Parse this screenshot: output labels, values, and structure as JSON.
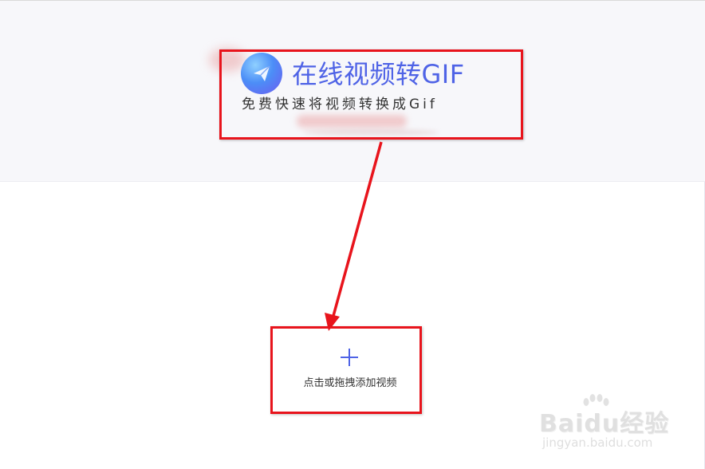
{
  "header": {
    "title": "在线视频转GIF",
    "subtitle": "免费快速将视频转换成Gif"
  },
  "upload": {
    "label": "点击或拖拽添加视频",
    "icon": "plus-icon"
  },
  "watermark": {
    "brand": "Baidu经验",
    "url": "jingyan.baidu.com"
  },
  "colors": {
    "accent": "#4f63e6",
    "annotation_red": "#e8141c",
    "header_bg": "#f7f7fa"
  }
}
